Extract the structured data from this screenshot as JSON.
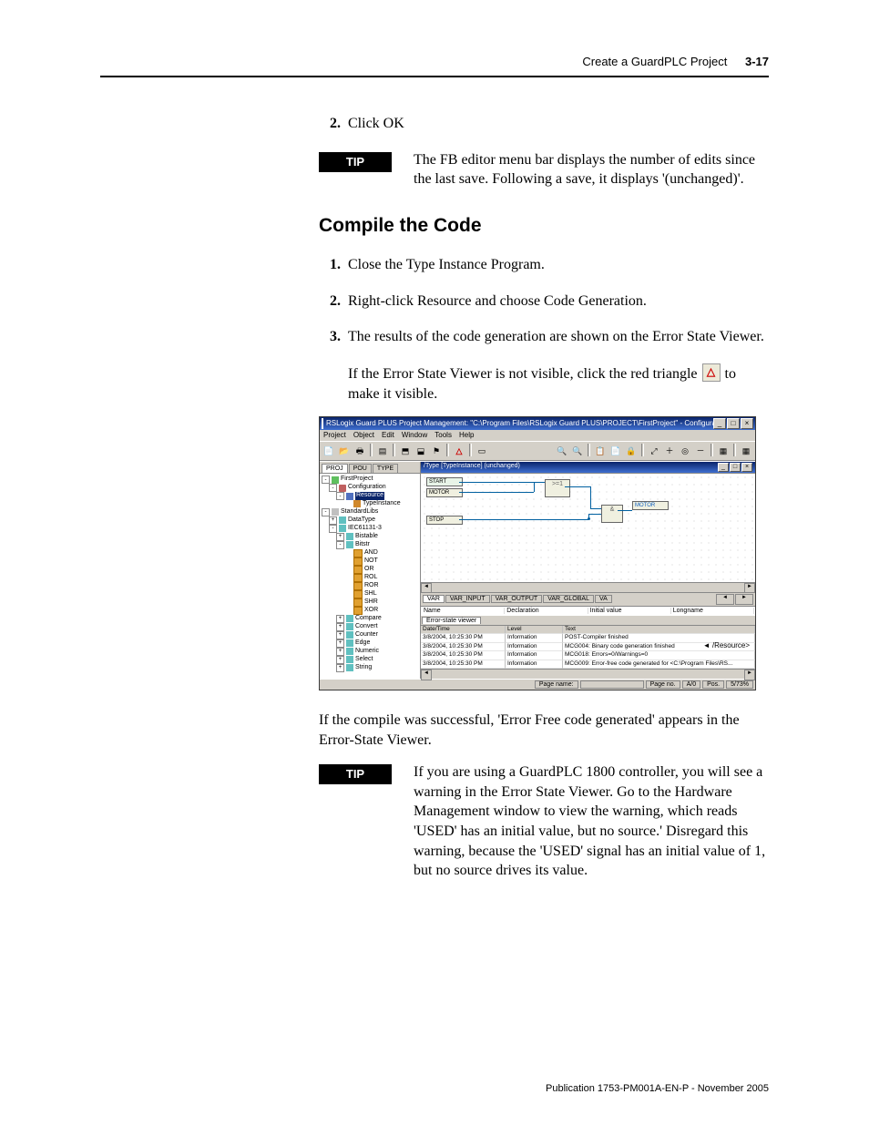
{
  "header": {
    "title": "Create a GuardPLC Project",
    "page_num": "3-17"
  },
  "step2": {
    "num": "2.",
    "text": "Click OK"
  },
  "tip_label": "TIP",
  "tip1_text": "The FB editor menu bar displays the number of edits since the last save. Following a save, it displays '(unchanged)'.",
  "h2": "Compile the Code",
  "steps": {
    "s1": {
      "num": "1.",
      "text": "Close the Type Instance Program."
    },
    "s2": {
      "num": "2.",
      "text": "Right-click Resource and choose Code Generation."
    },
    "s3": {
      "num": "3.",
      "text": "The results of the code generation are shown on the Error State Viewer."
    }
  },
  "visible_para": {
    "a": "If the Error State Viewer is not visible, click the red triangle ",
    "b": " to make it visible."
  },
  "icon_glyph": "△",
  "post_shot_para": "If the compile was successful, 'Error Free code generated' appears in the Error-State Viewer.",
  "tip2_text": "If you are using a GuardPLC 1800 controller, you will see a warning in the Error State Viewer. Go to the Hardware Management window to view the warning, which reads 'USED' has an initial value, but no source.' Disregard this warning, because the 'USED' signal has an initial value of 1, but no source drives its value.",
  "footer": "Publication 1753-PM001A-EN-P - November 2005",
  "shot": {
    "title": "RSLogix Guard PLUS Project Management: \"C:\\Program Files\\RSLogix Guard PLUS\\PROJECT\\FirstProject\" - Configuration\\Reso...",
    "winbtns": {
      "min": "_",
      "max": "□",
      "close": "×"
    },
    "menubar": [
      "Project",
      "Object",
      "Edit",
      "Window",
      "Tools",
      "Help"
    ],
    "tree_tabs": [
      "PROJ",
      "POU",
      "TYPE"
    ],
    "tree": {
      "root": "FirstProject",
      "cfg": "Configuration",
      "res": "Resource",
      "ti": "TypeInstance",
      "std": "StandardLibs",
      "dt": "DataType",
      "iec": "IEC61131-3",
      "bist": "Bistable",
      "bitstr": "Bitstr",
      "fbs": [
        "AND",
        "NOT",
        "OR",
        "ROL",
        "ROR",
        "SHL",
        "SHR",
        "XOR"
      ],
      "groups": [
        "Compare",
        "Convert",
        "Counter",
        "Edge",
        "Numeric",
        "Select",
        "String"
      ]
    },
    "fb_title": "/Type [TypeInstance] (unchanged)",
    "fb_blocks": {
      "start": "START",
      "motor_in": "MOTOR",
      "stop": "STOP",
      "ge1": ">=1",
      "and": "&",
      "motor_out": "MOTOR"
    },
    "var_tabs": [
      "VAR",
      "VAR_INPUT",
      "VAR_OUTPUT",
      "VAR_GLOBAL"
    ],
    "var_tabs_extra": "VA",
    "var_cols": [
      "Name",
      "Declaration",
      "Initial value",
      "Longname"
    ],
    "esv_tab": "Error-state viewer",
    "esv_head": [
      "Date/Time",
      "Level",
      "Text"
    ],
    "esv_rows": [
      {
        "dt": "3/8/2004, 10:25:30 PM",
        "lv": "Information",
        "tx": "POST-Compiler finished"
      },
      {
        "dt": "3/8/2004, 10:25:30 PM",
        "lv": "Information",
        "tx": "MCG004: Binary code generation finished"
      },
      {
        "dt": "3/8/2004, 10:25:30 PM",
        "lv": "Information",
        "tx": "MCG018: Errors=0/Warnings=0"
      },
      {
        "dt": "3/8/2004, 10:25:30 PM",
        "lv": "Information",
        "tx": "MCG009: Error-free code generated for <C:\\Program Files\\RS..."
      }
    ],
    "callout": "/Resource>",
    "callout_arrow": "◄",
    "status": {
      "page_name_label": "Page name:",
      "page_no_label": "Page no.",
      "page_no_val": "A/0",
      "pos_label": "Pos.",
      "pos_val": "5/73%"
    }
  }
}
